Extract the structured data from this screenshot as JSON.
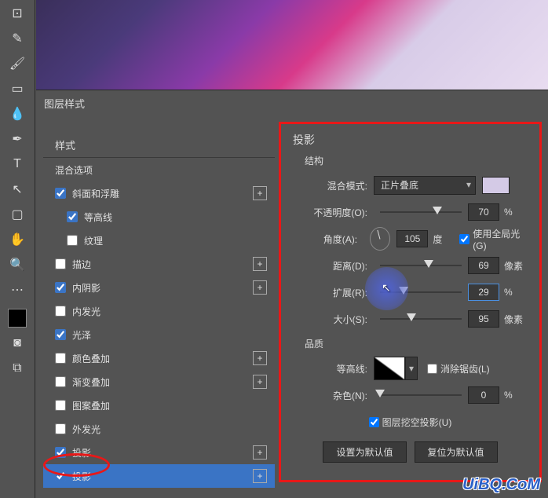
{
  "dialog_title": "图层样式",
  "styles_panel": {
    "heading": "样式",
    "blend_options": "混合选项",
    "items": [
      {
        "label": "斜面和浮雕",
        "checked": true,
        "plus": true
      },
      {
        "label": "等高线",
        "checked": true,
        "indent": true
      },
      {
        "label": "纹理",
        "checked": false,
        "indent": true
      },
      {
        "label": "描边",
        "checked": false,
        "plus": true
      },
      {
        "label": "内阴影",
        "checked": true,
        "plus": true
      },
      {
        "label": "内发光",
        "checked": false
      },
      {
        "label": "光泽",
        "checked": true
      },
      {
        "label": "颜色叠加",
        "checked": false,
        "plus": true
      },
      {
        "label": "渐变叠加",
        "checked": false,
        "plus": true
      },
      {
        "label": "图案叠加",
        "checked": false
      },
      {
        "label": "外发光",
        "checked": false
      },
      {
        "label": "投影",
        "checked": true,
        "plus": true
      },
      {
        "label": "投影",
        "checked": true,
        "plus": true,
        "selected": true
      }
    ]
  },
  "right_panel": {
    "title": "投影",
    "structure": "结构",
    "blend_mode_label": "混合模式:",
    "blend_mode_value": "正片叠底",
    "opacity_label": "不透明度(O):",
    "opacity_value": "70",
    "opacity_unit": "%",
    "angle_label": "角度(A):",
    "angle_value": "105",
    "angle_unit": "度",
    "global_light_label": "使用全局光 (G)",
    "distance_label": "距离(D):",
    "distance_value": "69",
    "distance_unit": "像素",
    "spread_label": "扩展(R):",
    "spread_value": "29",
    "spread_unit": "%",
    "size_label": "大小(S):",
    "size_value": "95",
    "size_unit": "像素",
    "quality": "品质",
    "contour_label": "等高线:",
    "antialias_label": "消除锯齿(L)",
    "noise_label": "杂色(N):",
    "noise_value": "0",
    "noise_unit": "%",
    "knockout_label": "图层挖空投影(U)",
    "make_default": "设置为默认值",
    "reset_default": "复位为默认值"
  },
  "watermark": "UiBQ.CoM"
}
